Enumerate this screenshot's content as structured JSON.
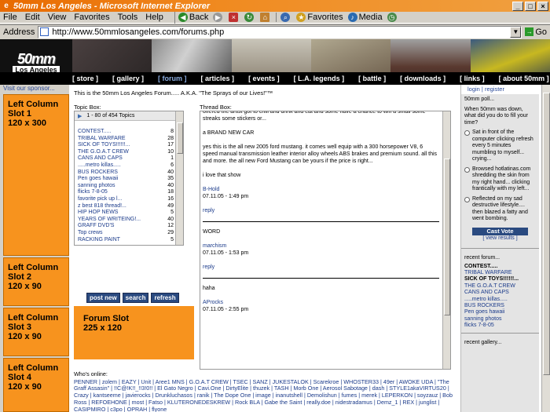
{
  "window": {
    "title": "50mm Los Angeles - Microsoft Internet Explorer"
  },
  "menu": [
    "File",
    "Edit",
    "View",
    "Favorites",
    "Tools",
    "Help"
  ],
  "toolbar": {
    "back": "Back",
    "favorites": "Favorites",
    "media": "Media"
  },
  "address": {
    "label": "Address",
    "url": "http://www.50mmlosangeles.com/forums.php",
    "go": "Go"
  },
  "logo": {
    "line1": "50mm",
    "line2": "Los Angeles"
  },
  "nav": [
    "[ store ]",
    "[ gallery ]",
    "[ forum ]",
    "[ articles ]",
    "[ events ]",
    "[ L.A. legends ]",
    "[ battle ]",
    "[ downloads ]",
    "[ links ]",
    "[ about 50mm ]"
  ],
  "left": {
    "sponsor": "Visit our sponsor...",
    "slots": [
      {
        "line1": "Left Column",
        "line2": "Slot 1",
        "line3": "120 x 300"
      },
      {
        "line1": "Left Column",
        "line2": "Slot 2",
        "line3": "120 x 90"
      },
      {
        "line1": "Left Column",
        "line2": "Slot 3",
        "line3": "120 x 90"
      },
      {
        "line1": "Left Column",
        "line2": "Slot 4",
        "line3": "120 x 90"
      }
    ]
  },
  "center": {
    "welcome": "This is the 50mm Los Angeles Forum..... A.K.A. \"The Sprays of our Lives!\"™",
    "topic_label": "Topic Box:",
    "topic_header": "1 - 80 of 454 Topics",
    "topics": [
      {
        "t": "CONTEST.....",
        "n": "8"
      },
      {
        "t": "TRIBAL WARFARE",
        "n": "28"
      },
      {
        "t": "SICK OF TOYS!!!!!!...",
        "n": "17"
      },
      {
        "t": "THE G.O.A.T CREW",
        "n": "10"
      },
      {
        "t": "CANS AND CAPS",
        "n": "1"
      },
      {
        "t": ".....metro killas.....",
        "n": "6"
      },
      {
        "t": "BUS ROCKERS",
        "n": "40"
      },
      {
        "t": "Pen goes hawaii",
        "n": "35"
      },
      {
        "t": "sanning photos",
        "n": "40"
      },
      {
        "t": "flicks 7-8-05",
        "n": "18"
      },
      {
        "t": "favorite pick up l...",
        "n": "16"
      },
      {
        "t": "z best 818 thread!...",
        "n": "49"
      },
      {
        "t": "HIP HOP NEWS",
        "n": "5"
      },
      {
        "t": "YEARS OF WRITEING!...",
        "n": "40"
      },
      {
        "t": "GRAFF DVD'S",
        "n": "12"
      },
      {
        "t": "Top crews",
        "n": "29"
      },
      {
        "t": "RACKING PAINT",
        "n": "5"
      }
    ],
    "buttons": [
      "post new",
      "search",
      "refresh"
    ],
    "forum_slot": {
      "line1": "Forum Slot",
      "line2": "225 x 120"
    },
    "thread_label": "Thread Box:",
    "post1": {
      "cut": "offered the artist got to chill and drink and eat and some have a chance to win a small some streaks some stickers or...",
      "title": "a BRAND NEW CAR",
      "body": "yes this is the all new 2005 ford mustang. it comes well equip with a 300 horsepower V8, 6 speed manual transmission leather interior alloy wheels ABS brakes and premium sound. all this and more. the all new Ford Mustang can be yours if the price is right...",
      "end": "i love that show",
      "author": "B-Hold",
      "date": "07.11.05 - 1:49 pm",
      "reply": "reply"
    },
    "post2": {
      "body": "WORD",
      "author": "marchism",
      "date": "07.11.05 - 1:53 pm",
      "reply": "reply"
    },
    "post3": {
      "body": "haha",
      "author": "AProcks",
      "date": "07.11.05 - 2:55 pm"
    },
    "online_label": "Who's online:",
    "online": "PENNER | zolem | EAZY | Unit | Aree1 MNS | G.O.A.T CREW | TSEC | SANZ | JUKESTALOK | Scarekroe | WHOSTER33 | 49er | AWOKE UDA | \"The Graff Assasin\" | !!C@!K!!_!!3!0!! | El Gato Negro | Cavi.One | DirtyElite | thuzek | TASH | Morb One | Aerosol Sabotage | dash | STYLE1akaVIRTUS20 | Crazy | kantseeme | javierocks | Drunkluchasos | ranik | The Dope One | image | inanutshell | Demolishun | fumes | merek | LEPERKON | soyzauz | Bob Ross | REFOEHONE | most | Fatso | KLUTERONEDESKREW | Rock BLA | Gabe the Saint | really.doe | nidestradamus | Demz_1 | REX | junglist | CASIPMIRO | c3po | OPRAH | flyone"
  },
  "right": {
    "login": "login | register",
    "poll_title": "50mm poll...",
    "poll_q": "When 50mm was down, what did you do to fill your time?",
    "options": [
      "Sat in front of the computer clicking refresh every 5 minutes mumbling to myself... crying...",
      "Browsed hotlatinas.com shredding the skin from my right hand... clicking frantically with my left...",
      "Reflected on my sad destructive lifestyle.... then blazed a fatty and went bombing."
    ],
    "vote": "Cast Vote",
    "view": "[ view results ]",
    "recent_title": "recent forum...",
    "recent": [
      {
        "t": "CONTEST.....",
        "bold": true
      },
      {
        "t": "TRIBAL WARFARE",
        "bold": false
      },
      {
        "t": "SICK OF TOYS!!!!!!...",
        "bold": true
      },
      {
        "t": "THE G.O.A.T CREW",
        "bold": false
      },
      {
        "t": "CANS AND CAPS",
        "bold": false
      },
      {
        "t": ".....metro killas.....",
        "bold": false
      },
      {
        "t": "BUS ROCKERS",
        "bold": false
      },
      {
        "t": "Pen goes hawaii",
        "bold": false
      },
      {
        "t": "sanning photos",
        "bold": false
      },
      {
        "t": "flicks 7-8-05",
        "bold": false
      }
    ],
    "gallery_title": "recent gallery..."
  }
}
